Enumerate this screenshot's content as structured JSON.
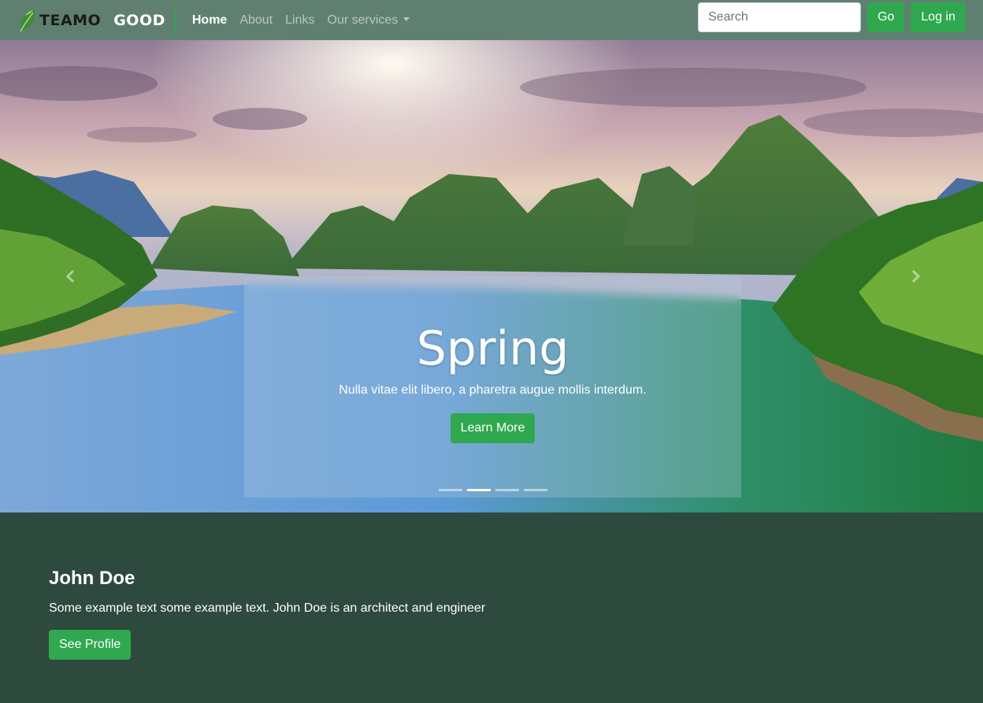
{
  "navbar": {
    "brand_part1": "TEAMO",
    "brand_part2": "GOOD",
    "links": [
      "Home",
      "About",
      "Links",
      "Our services"
    ],
    "search_placeholder": "Search",
    "go_label": "Go",
    "login_label": "Log in"
  },
  "carousel": {
    "title": "Spring",
    "text": "Nulla vitae elit libero, a pharetra augue mollis interdum.",
    "button_label": "Learn More",
    "indicator_count": 4,
    "active_indicator": 2,
    "prev_icon": "chevron-left-icon",
    "next_icon": "chevron-right-icon"
  },
  "profile": {
    "name": "John Doe",
    "text": "Some example text some example text. John Doe is an architect and engineer",
    "button_label": "See Profile"
  },
  "colors": {
    "navbar_bg": "#5f8070",
    "accent_green": "#2fa84f",
    "profile_bg": "#2e4a3e"
  }
}
